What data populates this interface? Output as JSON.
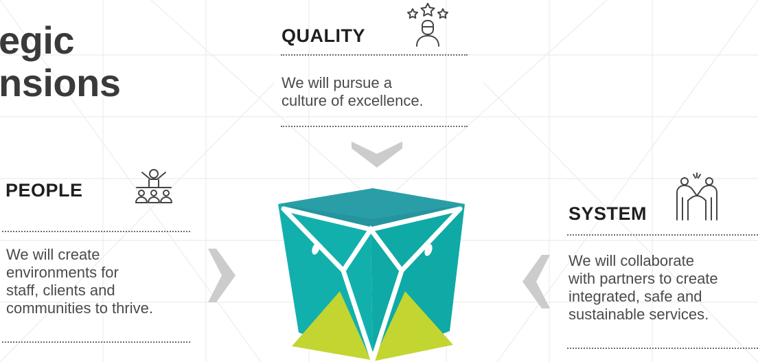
{
  "title": "egic\nnsions",
  "quality": {
    "heading": "QUALITY",
    "text": "We will pursue a\nculture of excellence.",
    "icon": "person-with-stars-icon"
  },
  "people": {
    "heading": "PEOPLE",
    "text": "We will create\nenvironments for\nstaff, clients and\ncommunities to thrive.",
    "icon": "group-leader-icon"
  },
  "system": {
    "heading": "SYSTEM",
    "text": "We will collaborate\nwith partners to create\nintegrated, safe and\nsustainable services.",
    "icon": "people-embracing-icon"
  },
  "colors": {
    "teal": "#12b0ad",
    "teal_top": "#2a9ea6",
    "lime": "#c3d531",
    "arrow_grey": "#cccccc",
    "heading": "#1f1f1f",
    "text": "#4a4a4a"
  }
}
